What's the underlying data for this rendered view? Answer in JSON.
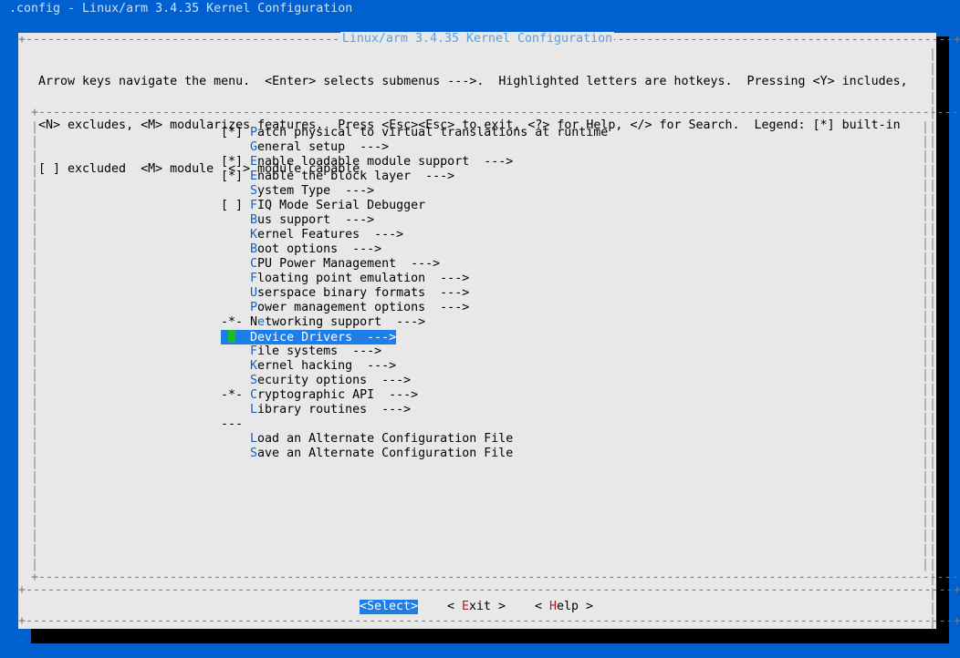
{
  "window": {
    "title": ".config - Linux/arm 3.4.35 Kernel Configuration"
  },
  "dialog": {
    "title": "Linux/arm 3.4.35 Kernel Configuration",
    "help_lines": [
      "Arrow keys navigate the menu.  <Enter> selects submenus --->.  Highlighted letters are hotkeys.  Pressing <Y> includes,",
      "<N> excludes, <M> modularizes features.  Press <Esc><Esc> to exit, <?> for Help, </> for Search.  Legend: [*] built-in",
      "[ ] excluded  <M> module  < > module capable"
    ]
  },
  "menu": {
    "items": [
      {
        "prefix": "[*] ",
        "hotkey": "P",
        "rest": "atch physical to virtual translations at runtime"
      },
      {
        "prefix": "    ",
        "hotkey": "G",
        "rest": "eneral setup  --->"
      },
      {
        "prefix": "[*] ",
        "hotkey": "E",
        "rest": "nable loadable module support  --->"
      },
      {
        "prefix": "[*] ",
        "hotkey": "E",
        "rest": "nable the block layer  --->"
      },
      {
        "prefix": "    ",
        "hotkey": "S",
        "rest": "ystem Type  --->"
      },
      {
        "prefix": "[ ] ",
        "hotkey": "F",
        "rest": "IQ Mode Serial Debugger"
      },
      {
        "prefix": "    ",
        "hotkey": "B",
        "rest": "us support  --->"
      },
      {
        "prefix": "    ",
        "hotkey": "K",
        "rest": "ernel Features  --->"
      },
      {
        "prefix": "    ",
        "hotkey": "B",
        "rest": "oot options  --->"
      },
      {
        "prefix": "    ",
        "hotkey": "C",
        "rest": "PU Power Management  --->"
      },
      {
        "prefix": "    ",
        "hotkey": "F",
        "rest": "loating point emulation  --->"
      },
      {
        "prefix": "    ",
        "hotkey": "U",
        "rest": "serspace binary formats  --->"
      },
      {
        "prefix": "    ",
        "hotkey": "P",
        "rest": "ower management options  --->"
      },
      {
        "prefix": "-*- ",
        "hotkey": "N",
        "rest": "etworking support  --->",
        "hotkey_pos": 1
      },
      {
        "prefix": "    ",
        "hotkey": "D",
        "rest": "evice Drivers  --->",
        "selected": true
      },
      {
        "prefix": "    ",
        "hotkey": "F",
        "rest": "ile systems  --->"
      },
      {
        "prefix": "    ",
        "hotkey": "K",
        "rest": "ernel hacking  --->"
      },
      {
        "prefix": "    ",
        "hotkey": "S",
        "rest": "ecurity options  --->"
      },
      {
        "prefix": "-*- ",
        "hotkey": "C",
        "rest": "ryptographic API  --->"
      },
      {
        "prefix": "    ",
        "hotkey": "L",
        "rest": "ibrary routines  --->"
      },
      {
        "prefix": "--- ",
        "hotkey": "",
        "rest": ""
      },
      {
        "prefix": "    ",
        "hotkey": "L",
        "rest": "oad an Alternate Configuration File"
      },
      {
        "prefix": "    ",
        "hotkey": "S",
        "rest": "ave an Alternate Configuration File"
      }
    ]
  },
  "buttons": {
    "select": "<Select>",
    "exit_pre": "< ",
    "exit_hotkey": "E",
    "exit_rest": "xit >",
    "help_pre": "< ",
    "help_hotkey": "H",
    "help_rest": "elp >"
  },
  "colors": {
    "background": "#0060d0",
    "dialog": "#e8e8e8",
    "selection": "#1e7ee8",
    "hotkey": "#1860c0",
    "cursor": "#16c020"
  }
}
